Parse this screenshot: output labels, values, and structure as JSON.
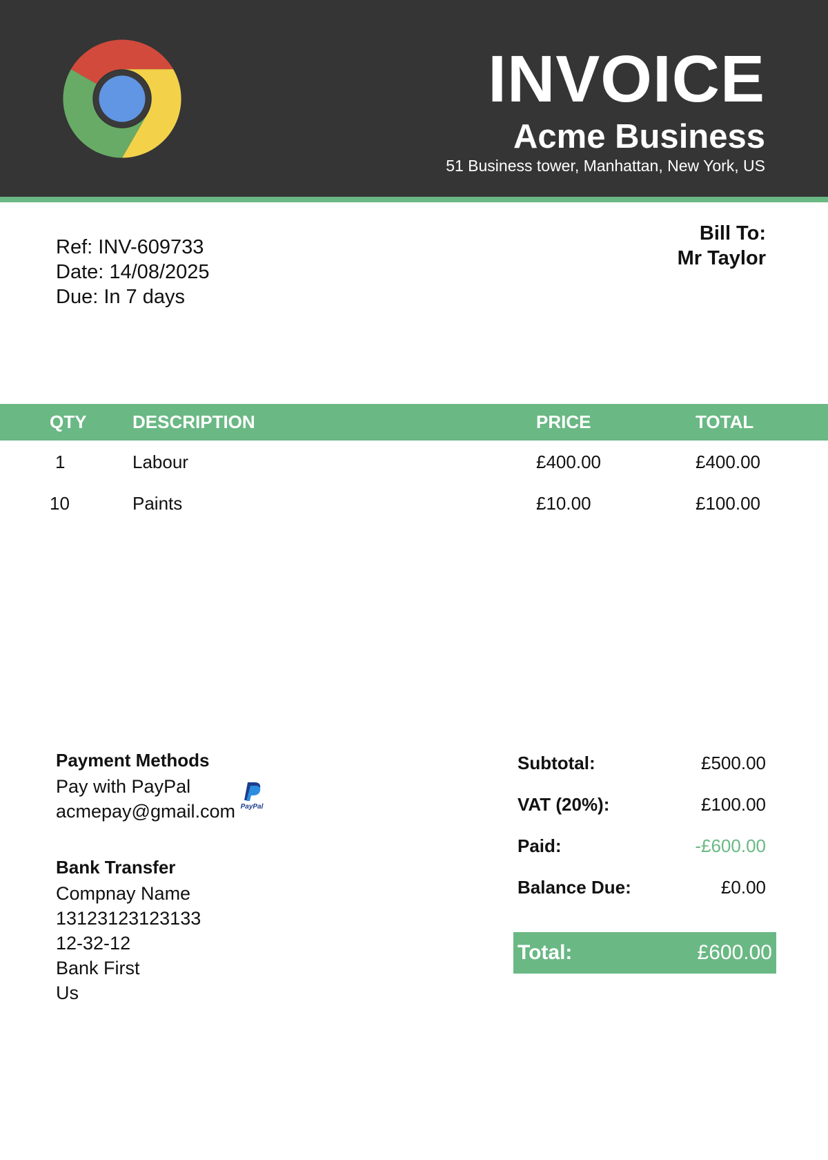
{
  "header": {
    "logo_icon": "chrome-logo-icon",
    "title": "INVOICE",
    "company_name": "Acme Business",
    "company_address": "51 Business tower, Manhattan, New York, US",
    "background_color": "#353535",
    "accent_color": "#6ab884"
  },
  "meta": {
    "ref": "Ref: INV-609733",
    "date": "Date: 14/08/2025",
    "due": "Due: In 7 days"
  },
  "bill_to": {
    "label": "Bill To:",
    "name": "Mr Taylor"
  },
  "items": {
    "headers": {
      "qty": "QTY",
      "description": "DESCRIPTION",
      "price": "PRICE",
      "total": "TOTAL"
    },
    "rows": [
      {
        "qty": "1",
        "description": "Labour",
        "price": "£400.00",
        "total": "£400.00"
      },
      {
        "qty": "10",
        "description": "Paints",
        "price": "£10.00",
        "total": "£100.00"
      }
    ]
  },
  "payment": {
    "heading": "Payment Methods",
    "paypal_label": "Pay with PayPal",
    "paypal_email": "acmepay@gmail.com",
    "paypal_icon": "paypal-icon",
    "paypal_badge_text": "PayPal"
  },
  "bank": {
    "heading": "Bank Transfer",
    "company": "Compnay Name",
    "account_number": "13123123123133",
    "sort_code": "12-32-12",
    "bank_name": "Bank First",
    "country": "Us"
  },
  "totals": {
    "subtotal_label": "Subtotal:",
    "subtotal_value": "£500.00",
    "vat_label": "VAT (20%):",
    "vat_value": "£100.00",
    "paid_label": "Paid:",
    "paid_value": "-£600.00",
    "balance_label": "Balance Due:",
    "balance_value": "£0.00",
    "total_label": "Total:",
    "total_value": "£600.00"
  }
}
